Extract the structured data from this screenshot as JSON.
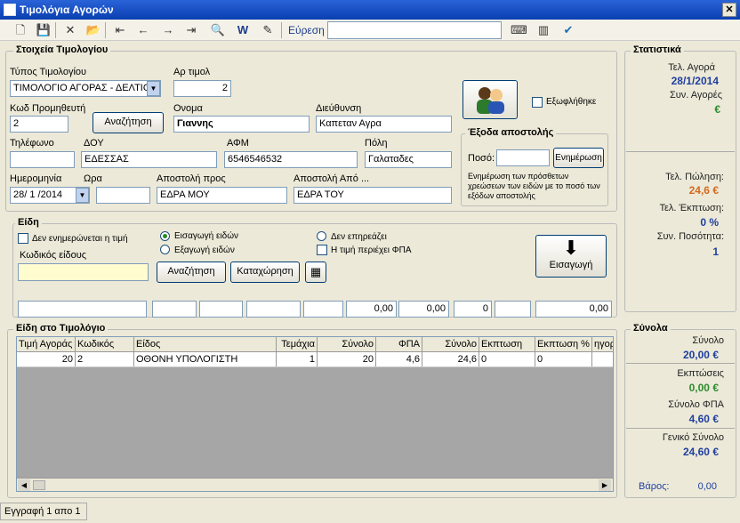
{
  "window": {
    "title": "Τιμολόγια Αγορών",
    "close_label": "✕"
  },
  "toolbar": {
    "search_label": "Εύρεση",
    "search_value": ""
  },
  "invoice": {
    "legend": "Στοιχεία Τιμολογίου",
    "type_label": "Τύπος Τιμολογίου",
    "type_value": "ΤΙΜΟΛΟΓΙΟ ΑΓΟΡΑΣ - ΔΕΛΤΙΟ",
    "number_label": "Αρ τιμολ",
    "number_value": "2",
    "supplier_code_label": "Κωδ Προμηθευτή",
    "supplier_code_value": "2",
    "search_button": "Αναζήτηση",
    "name_label": "Ονομα",
    "name_value": "Γιαννης",
    "address_label": "Διεύθυνση",
    "address_value": "Καπεταν Αγρα",
    "phone_label": "Τηλέφωνο",
    "phone_value": "",
    "doy_label": "ΔΟΥ",
    "doy_value": "ΕΔΕΣΣΑΣ",
    "afm_label": "ΑΦΜ",
    "afm_value": "6546546532",
    "city_label": "Πόλη",
    "city_value": "Γαλαταδες",
    "date_label": "Ημερομηνία",
    "date_value": "28/ 1 /2014",
    "time_label": "Ωρα",
    "time_value": "",
    "ship_to_label": "Αποστολή προς",
    "ship_to_value": "ΕΔΡΑ ΜΟΥ",
    "ship_from_label": "Αποστολή Από ...",
    "ship_from_value": "ΕΔΡΑ ΤΟΥ",
    "paid_label": "Εξωφλήθηκε"
  },
  "shipping": {
    "legend": "Έξοδα αποστολής",
    "amount_label": "Ποσό:",
    "amount_value": "",
    "update_button": "Ενημέρωση",
    "note": "Ενημέρωση των πρόσθετων χρεώσεων των ειδών με το ποσό των εξόδων αποστολής"
  },
  "items": {
    "legend": "Είδη",
    "no_update_price": "Δεν ενημερώνεται η τιμή",
    "import_items": "Εισαγωγή ειδών",
    "export_items": "Εξαγωγή ειδών",
    "no_effect": "Δεν επηρεάζει",
    "price_includes_vat": "Η τιμή περιέχει ΦΠΑ",
    "code_label": "Κωδικός είδους",
    "code_value": "",
    "search_button": "Αναζήτηση",
    "register_button": "Καταχώρηση",
    "insert_button": "Εισαγωγή",
    "line_values": [
      "",
      "",
      "",
      "",
      "",
      "0,00",
      "0,00",
      "0",
      "",
      "0,00"
    ]
  },
  "table": {
    "legend": "Είδη στο Τιμολόγιο",
    "columns": [
      "Τιμή Αγοράς",
      "Κωδικός",
      "Είδος",
      "Τεμάχια",
      "Σύνολο",
      "ΦΠΑ",
      "Σύνολο",
      "Εκπτωση",
      "Εκπτωση %",
      "ηγορ"
    ],
    "rows": [
      [
        "20",
        "2",
        "ΟΘΟΝΗ ΥΠΟΛΟΓΙΣΤΗ",
        "1",
        "20",
        "4,6",
        "24,6",
        "0",
        "0",
        ""
      ]
    ]
  },
  "stats": {
    "legend": "Στατιστικά",
    "last_purchase_label": "Τελ. Αγορά",
    "last_purchase_value": "28/1/2014",
    "total_purchases_label": "Συν. Αγορές",
    "total_purchases_value": "€",
    "last_sale_label": "Τελ. Πώληση:",
    "last_sale_value": "24,6 €",
    "last_discount_label": "Τελ. Έκπτωση:",
    "last_discount_value": "0 %",
    "total_qty_label": "Συν. Ποσότητα:",
    "total_qty_value": "1"
  },
  "totals": {
    "legend": "Σύνολα",
    "sum_label": "Σύνολο",
    "sum_value": "20,00 €",
    "discounts_label": "Εκπτώσεις",
    "discounts_value": "0,00 €",
    "vat_label": "Σύνολο ΦΠΑ",
    "vat_value": "4,60 €",
    "grand_label": "Γενικό Σύνολο",
    "grand_value": "24,60 €",
    "weight_label": "Βάρος:",
    "weight_value": "0,00"
  },
  "status": {
    "record": "Εγγραφή 1 απο 1"
  },
  "colors": {
    "blue": "#1F3FA0",
    "green": "#2E8B2E",
    "orange": "#D2691E",
    "title_bar": "#0A3FB0"
  }
}
